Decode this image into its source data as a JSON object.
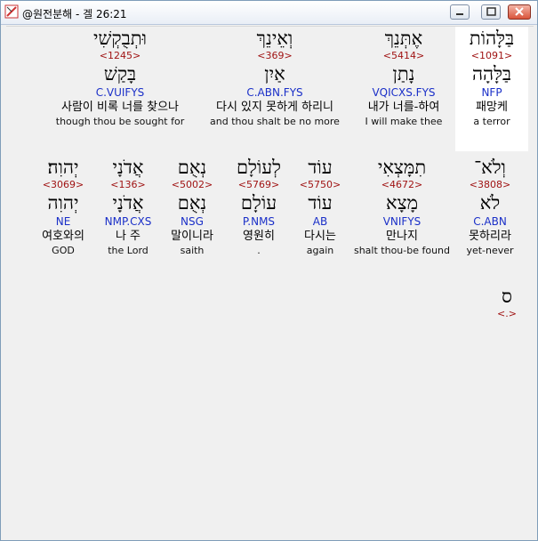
{
  "window": {
    "title": "@원전분해 - 겔 26:21"
  },
  "line1": [
    {
      "heb": "בַּלָּהוֹת",
      "strong": "<1091>",
      "lemma": "בַּלָּהָה",
      "morph": "NFP",
      "kor": "패망케",
      "eng": "a terror"
    },
    {
      "heb": "אֶתְּנֵךְ",
      "strong": "<5414>",
      "lemma": "נָתַן",
      "morph": "VQICXS.FYS",
      "kor": "내가 너를-하여",
      "eng": "I will make thee"
    },
    {
      "heb": "וְאֵינֵךְ",
      "strong": "<369>",
      "lemma": "אַיִן",
      "morph": "C.ABN.FYS",
      "kor": "다시 있지 못하게 하리니",
      "eng": "and thou shalt be no more"
    },
    {
      "heb": "וּתְבֻקְשִׁי",
      "strong": "<1245>",
      "lemma": "בָּקַשׁ",
      "morph": "C.VUIFYS",
      "kor": "사람이 비록 너를 찾으나",
      "eng": "though thou be sought for"
    }
  ],
  "line2": [
    {
      "heb": "וְלֹא־",
      "strong": "<3808>",
      "lemma": "לֹא",
      "morph": "C.ABN",
      "kor": "못하리라",
      "eng": "yet-never"
    },
    {
      "heb": "תִמָּצְאִי",
      "strong": "<4672>",
      "lemma": "מָצָא",
      "morph": "VNIFYS",
      "kor": "만나지",
      "eng": "shalt thou-be found"
    },
    {
      "heb": "עוֹד",
      "strong": "<5750>",
      "lemma": "עוֹד",
      "morph": "AB",
      "kor": "다시는",
      "eng": "again"
    },
    {
      "heb": "לְעוֹלָם",
      "strong": "<5769>",
      "lemma": "עוֹלָם",
      "morph": "P.NMS",
      "kor": "영원히",
      "eng": "."
    },
    {
      "heb": "נְאֻם",
      "strong": "<5002>",
      "lemma": "נְאֻם",
      "morph": "NSG",
      "kor": "말이니라",
      "eng": "saith"
    },
    {
      "heb": "אֲדֹנָי",
      "strong": "<136>",
      "lemma": "אֲדֹנָי",
      "morph": "NMP.CXS",
      "kor": "나 주",
      "eng": "the Lord"
    },
    {
      "heb": "יְהוִה׃",
      "strong": "<3069>",
      "lemma": "יְהוִה",
      "morph": "NE",
      "kor": "여호와의",
      "eng": "GOD"
    }
  ],
  "tail": {
    "heb": "ס",
    "strong": "<.>"
  }
}
